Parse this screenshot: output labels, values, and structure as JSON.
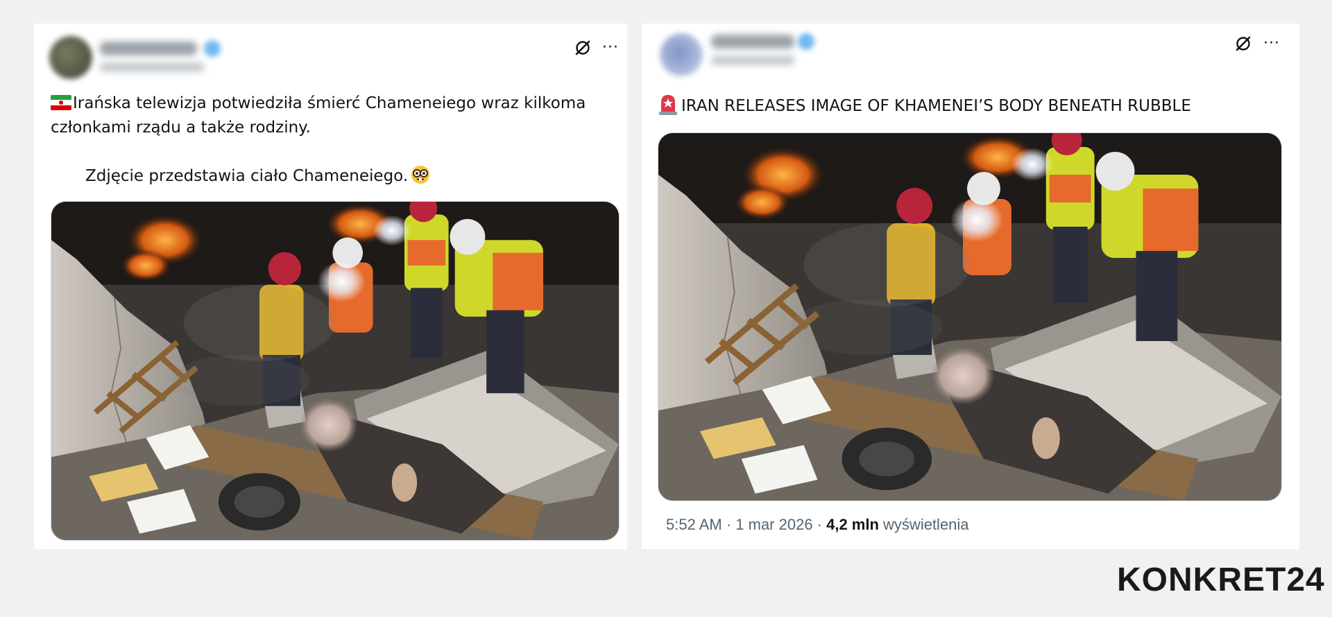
{
  "posts": [
    {
      "text_line1": "Irańska telewizja potwiedziła śmierć Chameneiego wraz kilkoma",
      "text_line2": "członkami rządu a także rodziny.",
      "text_line3": "Zdjęcie przedstawia ciało Chameneiego.",
      "icons": [
        "iran-flag-icon",
        "nerd-face-icon",
        "grok-icon",
        "more-icon"
      ]
    },
    {
      "text": "IRAN RELEASES IMAGE OF KHAMENEI’S BODY BENEATH RUBBLE",
      "meta": {
        "time_date": "5:52 AM · 1 mar 2026 · ",
        "views_count": "4,2 mln",
        "views_label": "wyświetlenia"
      },
      "icons": [
        "siren-icon",
        "grok-icon",
        "more-icon"
      ]
    }
  ],
  "watermark": {
    "brand": "KONKRET24"
  },
  "colors": {
    "background": "#f1f1f1",
    "card": "#ffffff",
    "text": "#0f1419",
    "muted": "#536471"
  }
}
